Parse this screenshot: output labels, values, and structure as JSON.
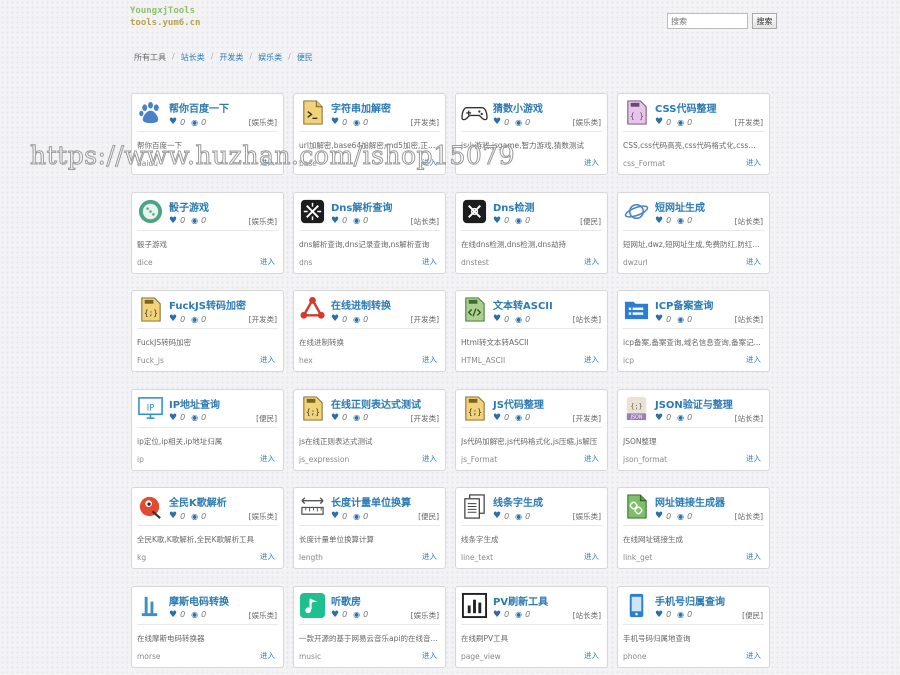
{
  "header": {
    "logo_line1": "YoungxjTools",
    "logo_line2": "tools.yum6.cn",
    "search_placeholder": "搜索",
    "search_button": "搜索"
  },
  "breadcrumb": [
    "所有工具",
    "站长类",
    "开发类",
    "娱乐类",
    "便民"
  ],
  "watermark": "https://www.huzhan.com/ishop15079",
  "enter_label": "进入",
  "tools": [
    {
      "title": "帮你百度一下",
      "likes": "0",
      "views": "0",
      "category": "[娱乐类]",
      "desc": "帮你百度一下",
      "slug": "baidu",
      "icon": "paw-icon"
    },
    {
      "title": "字符串加解密",
      "likes": "0",
      "views": "0",
      "category": "[开发类]",
      "desc": "url加解密,base64加解密,md5加密,正则...",
      "slug": "base",
      "icon": "terminal-file-icon"
    },
    {
      "title": "猜数小游戏",
      "likes": "0",
      "views": "0",
      "category": "[娱乐类]",
      "desc": "js小游戏,jsgame,智力游戏,猜数测试",
      "slug": "",
      "icon": "gamepad-icon"
    },
    {
      "title": "CSS代码整理",
      "likes": "0",
      "views": "0",
      "category": "[开发类]",
      "desc": "CSS,css代码高亮,css代码格式化,css代码...",
      "slug": "css_Format",
      "icon": "css-file-icon"
    },
    {
      "title": "骰子游戏",
      "likes": "0",
      "views": "0",
      "category": "[娱乐类]",
      "desc": "骰子游戏",
      "slug": "dice",
      "icon": "dice-icon"
    },
    {
      "title": "Dns解析查询",
      "likes": "0",
      "views": "0",
      "category": "[站长类]",
      "desc": "dns解析查询,dns记录查询,ns解析查询",
      "slug": "dns",
      "icon": "dns-icon"
    },
    {
      "title": "Dns检测",
      "likes": "0",
      "views": "0",
      "category": "[便民]",
      "desc": "在线dns检测,dns检测,dns劫持",
      "slug": "dnstest",
      "icon": "dns-check-icon"
    },
    {
      "title": "短网址生成",
      "likes": "0",
      "views": "0",
      "category": "[站长类]",
      "desc": "短网址,dwz,短网址生成,免费防红,防红接...",
      "slug": "dwzurl",
      "icon": "planet-icon"
    },
    {
      "title": "FuckJS转码加密",
      "likes": "0",
      "views": "0",
      "category": "[开发类]",
      "desc": "FuckJS转码加密",
      "slug": "Fuck_js",
      "icon": "js-file-icon"
    },
    {
      "title": "在线进制转换",
      "likes": "0",
      "views": "0",
      "category": "[开发类]",
      "desc": "在线进制转换",
      "slug": "hex",
      "icon": "network-icon"
    },
    {
      "title": "文本转ASCII",
      "likes": "0",
      "views": "0",
      "category": "[站长类]",
      "desc": "Html转文本转ASCII",
      "slug": "HTML_ASCII",
      "icon": "html-file-icon"
    },
    {
      "title": "ICP备案查询",
      "likes": "0",
      "views": "0",
      "category": "[站长类]",
      "desc": "icp备案,备案查询,域名信息查询,备案记...",
      "slug": "icp",
      "icon": "folder-list-icon"
    },
    {
      "title": "IP地址查询",
      "likes": "0",
      "views": "0",
      "category": "[便民]",
      "desc": "ip定位,ip相关,ip地址归属",
      "slug": "ip",
      "icon": "ip-monitor-icon"
    },
    {
      "title": "在线正则表达式测试",
      "likes": "0",
      "views": "0",
      "category": "[开发类]",
      "desc": "js在线正则表达式测试",
      "slug": "js_expression",
      "icon": "js-file-icon"
    },
    {
      "title": "JS代码整理",
      "likes": "0",
      "views": "0",
      "category": "[开发类]",
      "desc": "Js代码加解密,js代码格式化,js压缩,js解压",
      "slug": "js_Format",
      "icon": "js-file-icon"
    },
    {
      "title": "JSON验证与整理",
      "likes": "0",
      "views": "0",
      "category": "[站长类]",
      "desc": "JSON整理",
      "slug": "json_format",
      "icon": "json-icon"
    },
    {
      "title": "全民K歌解析",
      "likes": "0",
      "views": "0",
      "category": "[娱乐类]",
      "desc": "全民K歌,K歌解析,全民K歌解析工具",
      "slug": "kg",
      "icon": "bird-icon"
    },
    {
      "title": "长度计量单位换算",
      "likes": "0",
      "views": "0",
      "category": "[便民]",
      "desc": "长度计量单位换算计算",
      "slug": "length",
      "icon": "ruler-icon"
    },
    {
      "title": "线条字生成",
      "likes": "0",
      "views": "0",
      "category": "[娱乐类]",
      "desc": "线条字生成",
      "slug": "line_text",
      "icon": "documents-icon"
    },
    {
      "title": "网址链接生成器",
      "likes": "0",
      "views": "0",
      "category": "[站长类]",
      "desc": "在线网址链接生成",
      "slug": "link_get",
      "icon": "link-file-icon"
    },
    {
      "title": "摩斯电码转换",
      "likes": "0",
      "views": "0",
      "category": "[娱乐类]",
      "desc": "在线摩斯电码转换器",
      "slug": "morse",
      "icon": "morse-icon"
    },
    {
      "title": "听歌房",
      "likes": "0",
      "views": "0",
      "category": "[娱乐类]",
      "desc": "一款开源的基于网易云音乐api的在线音...",
      "slug": "music",
      "icon": "music-note-icon"
    },
    {
      "title": "PV刷新工具",
      "likes": "0",
      "views": "0",
      "category": "[站长类]",
      "desc": "在线刷PV工具",
      "slug": "page_view",
      "icon": "bar-chart-icon"
    },
    {
      "title": "手机号归属查询",
      "likes": "0",
      "views": "0",
      "category": "[便民]",
      "desc": "手机号码归属地查询",
      "slug": "phone",
      "icon": "phone-icon"
    }
  ]
}
